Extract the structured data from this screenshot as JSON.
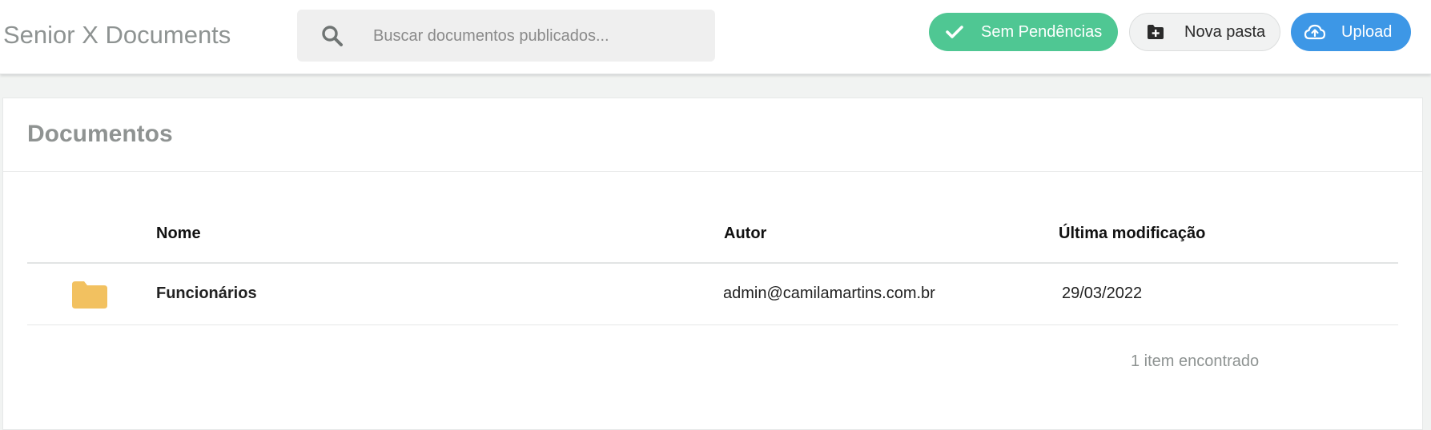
{
  "header": {
    "app_title": "Senior X Documents",
    "search": {
      "placeholder": "Buscar documentos publicados...",
      "value": "",
      "icon": "search-icon"
    },
    "buttons": {
      "pendencias": {
        "label": "Sem Pendências",
        "icon": "check-icon",
        "color": "#4fc793"
      },
      "new_folder": {
        "label": "Nova pasta",
        "icon": "folder-plus-icon",
        "color": "#f1f2f2"
      },
      "upload": {
        "label": "Upload",
        "icon": "cloud-upload-icon",
        "color": "#3d97e6"
      }
    }
  },
  "main": {
    "title": "Documentos",
    "table": {
      "columns": [
        "Nome",
        "Autor",
        "Última modificação"
      ],
      "rows": [
        {
          "icon": "folder-icon",
          "name": "Funcionários",
          "author": "admin@camilamartins.com.br",
          "modified": "29/03/2022"
        }
      ]
    },
    "result_count": "1 item encontrado"
  },
  "colors": {
    "folder": "#f2c160",
    "accent_green": "#4fc793",
    "accent_blue": "#3d97e6"
  }
}
